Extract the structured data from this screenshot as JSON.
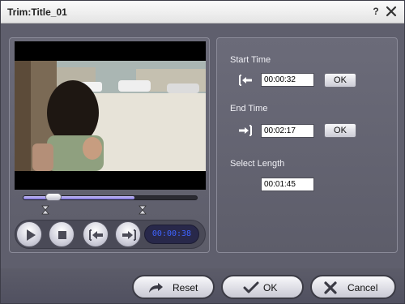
{
  "window": {
    "title": "Trim:Title_01",
    "help_glyph": "?",
    "close_icon": "close-icon"
  },
  "player": {
    "progress_fraction": 0.64,
    "current_time": "00:00:38",
    "start_marker_fraction": 0.13,
    "end_marker_fraction": 0.7,
    "icons": [
      "play-icon",
      "stop-icon",
      "set-start-icon",
      "set-end-icon"
    ]
  },
  "trim": {
    "start_time": {
      "label": "Start Time",
      "value": "00:00:32",
      "ok_label": "OK"
    },
    "end_time": {
      "label": "End Time",
      "value": "00:02:17",
      "ok_label": "OK"
    },
    "select_length": {
      "label": "Select Length",
      "value": "00:01:45"
    }
  },
  "footer": {
    "reset_label": "Reset",
    "ok_label": "OK",
    "cancel_label": "Cancel"
  },
  "colors": {
    "accent": "#7e72d8",
    "time_text": "#3f64ff"
  }
}
